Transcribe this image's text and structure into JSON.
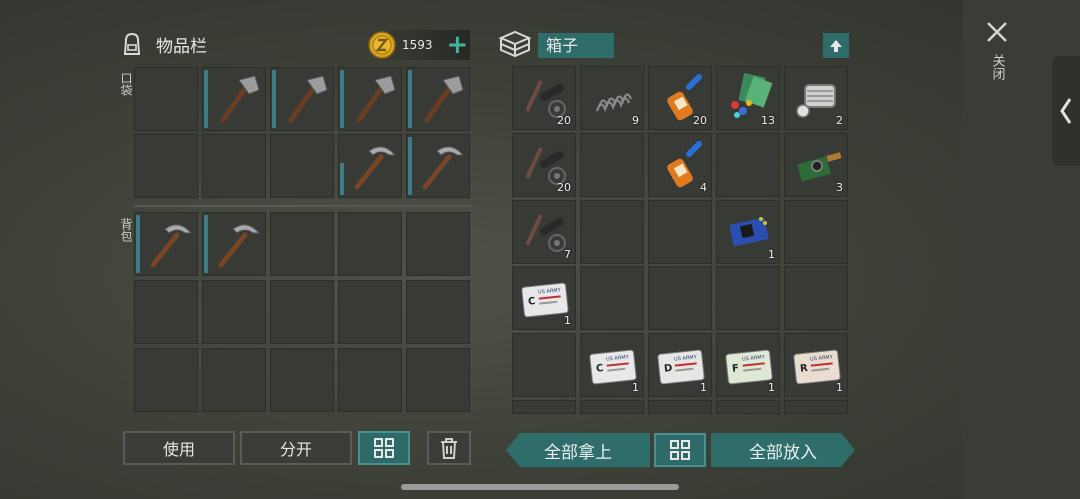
{
  "inventory": {
    "title": "物品栏",
    "coins": "1593",
    "pocket_label": "口袋",
    "backpack_label": "背包"
  },
  "box": {
    "title": "箱子"
  },
  "buttons": {
    "use": "使用",
    "split": "分开",
    "take_all": "全部拿上",
    "put_all": "全部放入"
  },
  "close_label": "关闭",
  "box_items": [
    {
      "icon": "crossbow-parts-icon",
      "count": "20"
    },
    {
      "icon": "spring-icon",
      "count": "9"
    },
    {
      "icon": "glue-icon",
      "count": "20"
    },
    {
      "icon": "electronics-parts-icon",
      "count": "13"
    },
    {
      "icon": "engine-block-icon",
      "count": "2"
    },
    {
      "icon": "crossbow-parts-icon",
      "count": "20"
    },
    {
      "icon": "glue-icon",
      "count": "4"
    },
    {
      "icon": "camera-module-icon",
      "count": "3"
    },
    {
      "icon": "crossbow-parts-icon",
      "count": "7"
    },
    {
      "icon": "circuit-board-icon",
      "count": "1"
    },
    {
      "icon": "keycard-c-icon",
      "count": "1"
    },
    {
      "icon": "keycard-c-icon",
      "count": "1"
    },
    {
      "icon": "keycard-d-icon",
      "count": "1"
    },
    {
      "icon": "keycard-f-icon",
      "count": "1"
    },
    {
      "icon": "keycard-r-icon",
      "count": "1"
    }
  ],
  "card_letters": {
    "c": "C",
    "d": "D",
    "f": "F",
    "r": "R",
    "army": "US ARMY"
  }
}
